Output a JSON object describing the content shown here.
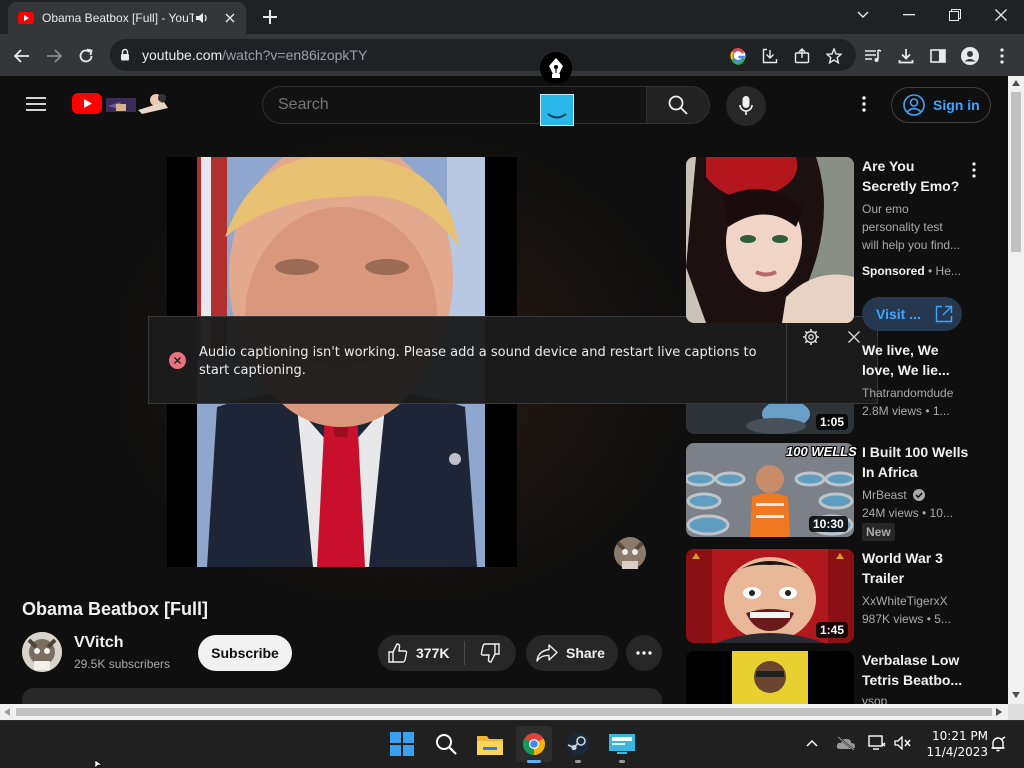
{
  "browser": {
    "tab_title": "Obama Beatbox [Full] - YouTube",
    "url_host": "youtube.com",
    "url_path": "/watch?v=en86izopkTY"
  },
  "header": {
    "search_placeholder": "Search",
    "sign_in": "Sign in"
  },
  "caption_notice": {
    "message": "Audio captioning isn't working. Please add a sound device and restart live captions to start captioning."
  },
  "video": {
    "title": "Obama Beatbox [Full]",
    "channel": "VVitch",
    "subscribers": "29.5K subscribers",
    "subscribe_label": "Subscribe",
    "likes": "377K",
    "share_label": "Share"
  },
  "sidebar": {
    "ad": {
      "title": "Are You Secretly Emo?",
      "description": "Our emo personality test will help you find...",
      "sponsored": "Sponsored",
      "advertiser": "He...",
      "visit_label": "Visit ..."
    },
    "items": [
      {
        "title": "We live, We love, We lie...",
        "channel": "Thatrandomdude",
        "meta": "2.8M views • 1...",
        "duration": "1:05"
      },
      {
        "title": "I Built 100 Wells In Africa",
        "channel": "MrBeast",
        "meta": "24M views • 10...",
        "duration": "10:30",
        "badge": "New",
        "thumb_text": "100 WELLS"
      },
      {
        "title": "World War 3 Trailer",
        "channel": "XxWhiteTigerxX",
        "meta": "987K views • 5...",
        "duration": "1:45"
      },
      {
        "title": "Verbalase Low Tetris Beatbo...",
        "channel": "vsop",
        "meta": "",
        "duration": ""
      }
    ]
  },
  "taskbar": {
    "time": "10:21 PM",
    "date": "11/4/2023"
  },
  "colors": {
    "yt_red": "#ff0000",
    "link_blue": "#3ea6ff",
    "error_pink": "#e9727f"
  }
}
